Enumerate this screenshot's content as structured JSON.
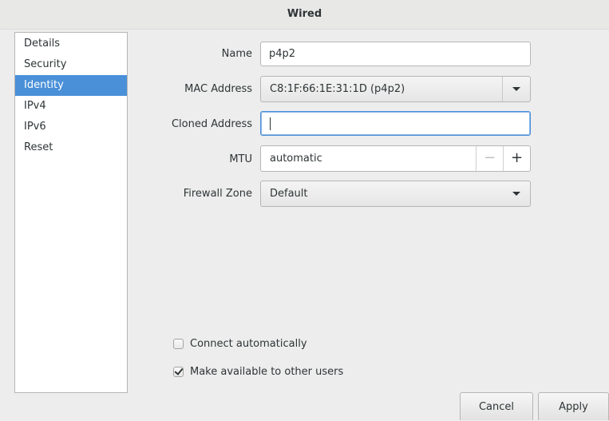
{
  "window": {
    "title": "Wired"
  },
  "sidebar": {
    "items": [
      {
        "label": "Details"
      },
      {
        "label": "Security"
      },
      {
        "label": "Identity"
      },
      {
        "label": "IPv4"
      },
      {
        "label": "IPv6"
      },
      {
        "label": "Reset"
      }
    ],
    "selected": "Identity"
  },
  "form": {
    "name_label": "Name",
    "name_value": "p4p2",
    "mac_label": "MAC Address",
    "mac_value": "C8:1F:66:1E:31:1D (p4p2)",
    "cloned_label": "Cloned Address",
    "cloned_value": "",
    "mtu_label": "MTU",
    "mtu_value": "automatic",
    "mtu_minus": "−",
    "mtu_plus": "+",
    "firewall_label": "Firewall Zone",
    "firewall_value": "Default"
  },
  "options": {
    "connect_auto_label": "Connect automatically",
    "connect_auto_checked": false,
    "available_label": "Make available to other users",
    "available_checked": true
  },
  "buttons": {
    "cancel": "Cancel",
    "apply": "Apply"
  },
  "icons": {
    "dropdown": "chevron-down-icon",
    "check": "check-icon"
  },
  "colors": {
    "accent": "#4a90d9",
    "text": "#2e3436",
    "background": "#ededed"
  }
}
